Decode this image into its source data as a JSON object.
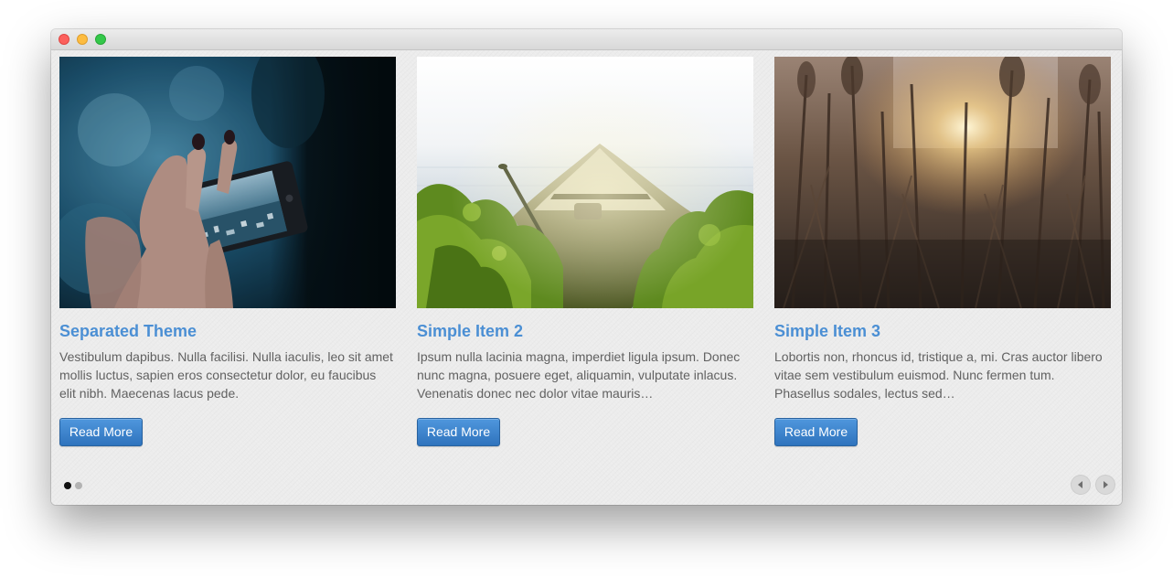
{
  "window": {
    "controls": [
      "close",
      "minimize",
      "maximize"
    ]
  },
  "carousel": {
    "items": [
      {
        "image_icon": "photo-hand-smartphone",
        "title": "Separated Theme",
        "text": "Vestibulum dapibus. Nulla facilisi. Nulla iaculis, leo sit amet mollis luctus, sapien eros consectetur dolor, eu faucibus elit nibh. Maecenas lacus pede.",
        "button": "Read More"
      },
      {
        "image_icon": "photo-canoe-on-lake",
        "title": "Simple Item 2",
        "text": "Ipsum nulla lacinia magna, imperdiet ligula ipsum. Donec nunc magna, posuere eget, aliquamin, vulputate inlacus. Venenatis donec nec dolor vitae mauris…",
        "button": "Read More"
      },
      {
        "image_icon": "photo-reeds-sunset",
        "title": "Simple Item 3",
        "text": "Lobortis non, rhoncus id, tristique a, mi. Cras auctor libero vitae sem vestibulum euismod. Nunc fermen tum. Phasellus sodales, lectus sed…",
        "button": "Read More"
      }
    ],
    "pagination": {
      "pages": 2,
      "active": 1
    },
    "nav": {
      "prev_icon": "chevron-left-icon",
      "next_icon": "chevron-right-icon"
    }
  },
  "colors": {
    "title": "#4b8fd4",
    "button": "#3a82cc",
    "text": "#616161",
    "background": "#ececec"
  }
}
